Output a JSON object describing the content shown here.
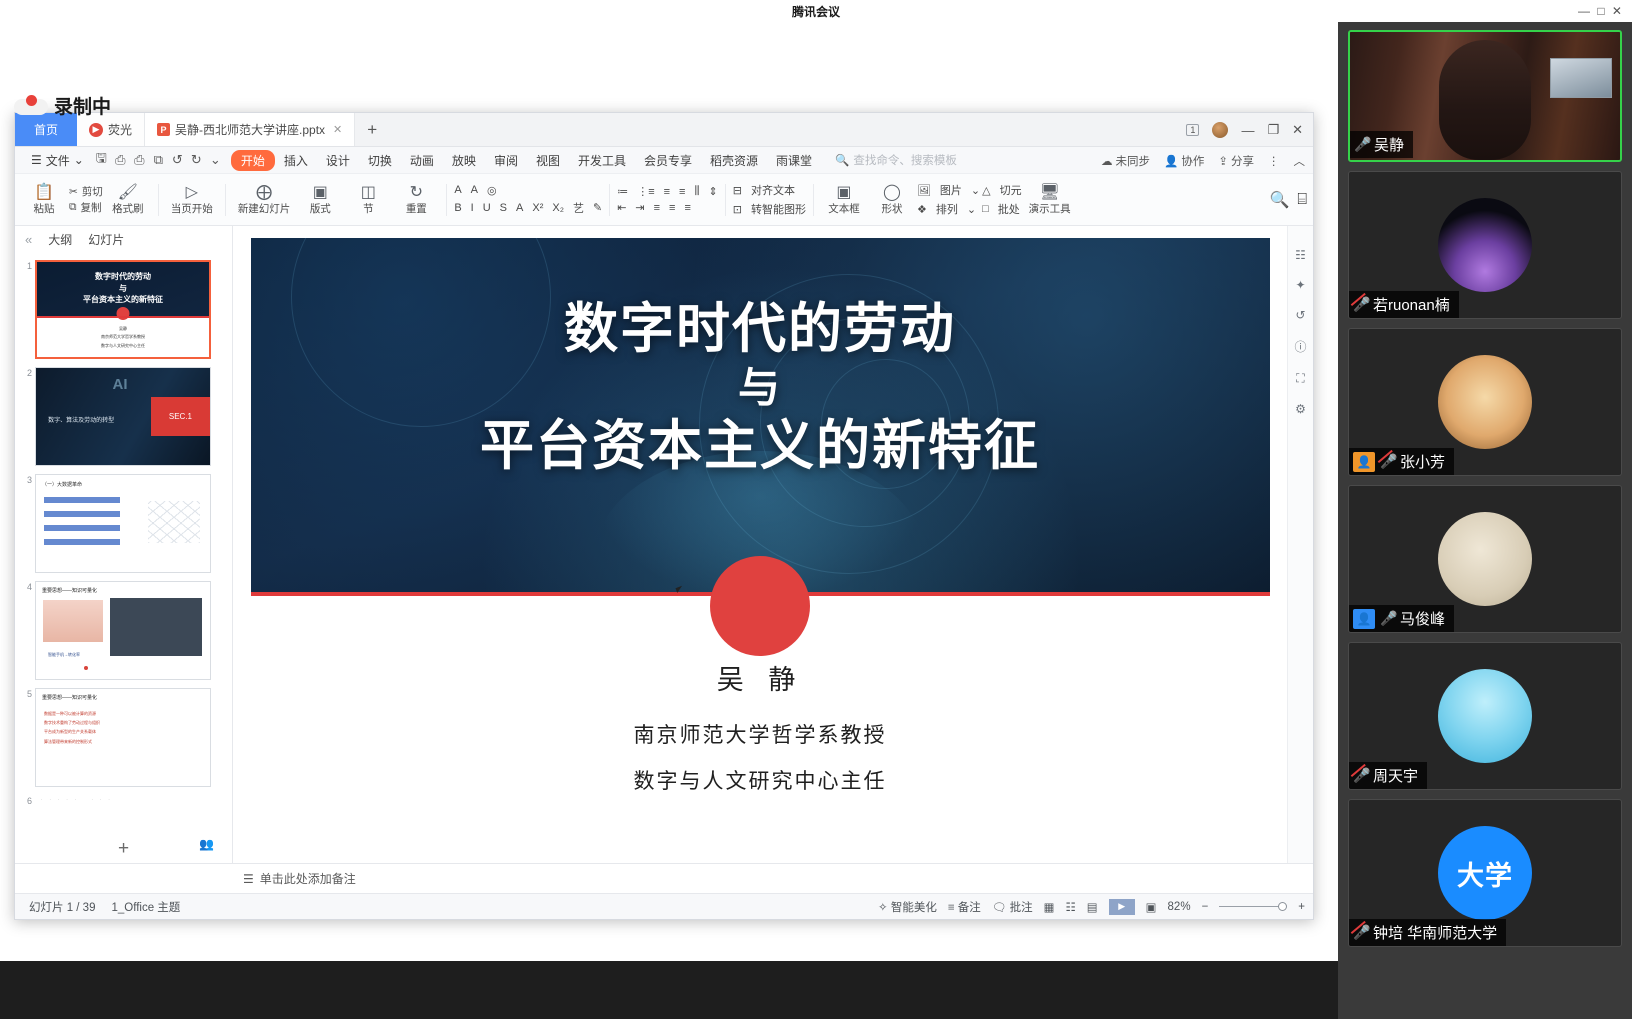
{
  "meeting": {
    "title": "腾讯会议",
    "window_controls": "— □ ✕",
    "recording_label": "录制中"
  },
  "wps": {
    "titlebar": {
      "home_tab": "首页",
      "live_tab": "荧光",
      "doc_tab": "吴静-西北师范大学讲座.pptx",
      "doc_icon": "pptx-file-icon",
      "tab_close": "✕",
      "new_tab": "+",
      "window_chip": "1",
      "minimize": "—",
      "maximize": "❐",
      "close": "✕"
    },
    "menu": {
      "file": "文件",
      "quick_icons": [
        "save-icon",
        "save-as-icon",
        "print-icon",
        "print-preview-icon",
        "undo-icon",
        "redo-icon",
        "customize-icon"
      ],
      "tabs": [
        "开始",
        "插入",
        "设计",
        "切换",
        "动画",
        "放映",
        "审阅",
        "视图",
        "开发工具",
        "会员专享",
        "稻壳资源",
        "雨课堂"
      ],
      "selected_tab": "开始",
      "search_placeholder": "查找命令、搜索模板",
      "sync_status": "未同步",
      "collaborate": "协作",
      "share": "分享",
      "more": "⋮",
      "collapse": "︿"
    },
    "ribbon": {
      "groups": [
        {
          "icon": "paste-icon",
          "label": "粘贴"
        },
        {
          "icon": "cut-icon",
          "label": "剪切"
        },
        {
          "icon": "copy-icon",
          "label": "复制"
        },
        {
          "icon": "format-painter-icon",
          "label": "格式刷"
        },
        {
          "icon": "play-from-current-icon",
          "label": "当页开始"
        },
        {
          "icon": "new-slide-icon",
          "label": "新建幻灯片"
        },
        {
          "icon": "layout-icon",
          "label": "版式"
        },
        {
          "icon": "section-icon",
          "label": "节"
        },
        {
          "icon": "reset-icon",
          "label": "重置"
        }
      ],
      "font_tools": {
        "bold": "B",
        "italic": "I",
        "underline": "U",
        "strike": "S",
        "font_color": "A",
        "superscript": "X²",
        "subscript": "X₂",
        "text_effect": "艺",
        "highlight": "✎",
        "grow_font": "A",
        "shrink_font": "A",
        "clear_format": "◎"
      },
      "paragraph_tools": {
        "bullets": "≔",
        "numbering": "⋮≡",
        "indent_dec": "⇤",
        "indent_inc": "⇥",
        "align_left": "≡",
        "align_center": "≡",
        "align_right": "≡",
        "justify": "≡",
        "distribute": "≡",
        "line_spacing": "⇕",
        "columns": "⫼",
        "align_text": "对齐文本",
        "smart_art": "转智能图形"
      },
      "right_tools": [
        {
          "icon": "text-box-icon",
          "label": "文本框"
        },
        {
          "icon": "shape-icon",
          "label": "形状"
        },
        {
          "icon": "picture-icon",
          "label": "图片"
        },
        {
          "icon": "arrange-icon",
          "label": "排列"
        },
        {
          "icon": "unit-icon",
          "label": "切元"
        },
        {
          "icon": "batch-icon",
          "label": "批处"
        },
        {
          "icon": "present-tools-icon",
          "label": "演示工具"
        }
      ],
      "find_icon": "search-icon",
      "select_icon": "select-icon"
    },
    "left_pane": {
      "collapse": "«",
      "tabs": [
        "大纲",
        "幻灯片"
      ],
      "selected_tab": "幻灯片",
      "thumbnails": [
        {
          "num": "1",
          "title_line1": "数字时代的劳动",
          "title_line2": "与",
          "title_line3": "平台资本主义的新特征",
          "selected": true
        },
        {
          "num": "2",
          "caption": "数字、算法及劳动的转型",
          "tag": "SEC.1"
        },
        {
          "num": "3",
          "caption": "（一）大数据革命"
        },
        {
          "num": "4",
          "caption": "重要思想——知识可量化"
        },
        {
          "num": "5",
          "caption": "重要思想——知识可量化"
        },
        {
          "num": "6",
          "caption": ""
        }
      ],
      "add_slide": "+"
    },
    "notes_placeholder": "单击此处添加备注",
    "notes_icon": "notes-icon",
    "status": {
      "slide_counter": "幻灯片 1 / 39",
      "theme": "1_Office 主题",
      "beautify": "智能美化",
      "notes_btn": "备注",
      "comments_btn": "批注",
      "view_normal": "normal-view-icon",
      "view_sorter": "slide-sorter-icon",
      "view_reading": "reading-view-icon",
      "play": "▶",
      "fit_icon": "fit-slide-icon",
      "zoom": "82%",
      "zoom_out": "−",
      "zoom_in": "+"
    }
  },
  "slide": {
    "title_line1": "数字时代的劳动",
    "title_line2": "与",
    "title_line3": "平台资本主义的新特征",
    "author": "吴 静",
    "affil_1": "南京师范大学哲学系教授",
    "affil_2": "数字与人文研究中心主任"
  },
  "participants": [
    {
      "name": "吴静",
      "mic": "on",
      "speaking": true,
      "video": true,
      "role": null,
      "avatar": "self-video"
    },
    {
      "name": "若ruonan楠",
      "mic": "off",
      "speaking": false,
      "video": false,
      "role": null,
      "avatar": "avatar-piano"
    },
    {
      "name": "张小芳",
      "mic": "off",
      "speaking": false,
      "video": false,
      "role": "host",
      "role_color": "#f0962a",
      "avatar": "avatar-girl"
    },
    {
      "name": "马俊峰",
      "mic": "on",
      "speaking": false,
      "video": false,
      "role": "cohost",
      "role_color": "#2f8df5",
      "avatar": "avatar-umbrella"
    },
    {
      "name": "周天宇",
      "mic": "off",
      "speaking": false,
      "video": false,
      "role": null,
      "avatar": "avatar-traveler"
    },
    {
      "name": "钟培 华南师范大学",
      "mic": "off",
      "speaking": false,
      "video": false,
      "role": null,
      "avatar": "avatar-uni",
      "avatar_text": "大学"
    }
  ],
  "colors": {
    "accent_orange": "#ff6a3d",
    "accent_blue": "#4a8cf7",
    "speaking_green": "#35d24a",
    "slide_red": "#e0413f",
    "panel_bg": "#3a3a3a"
  }
}
